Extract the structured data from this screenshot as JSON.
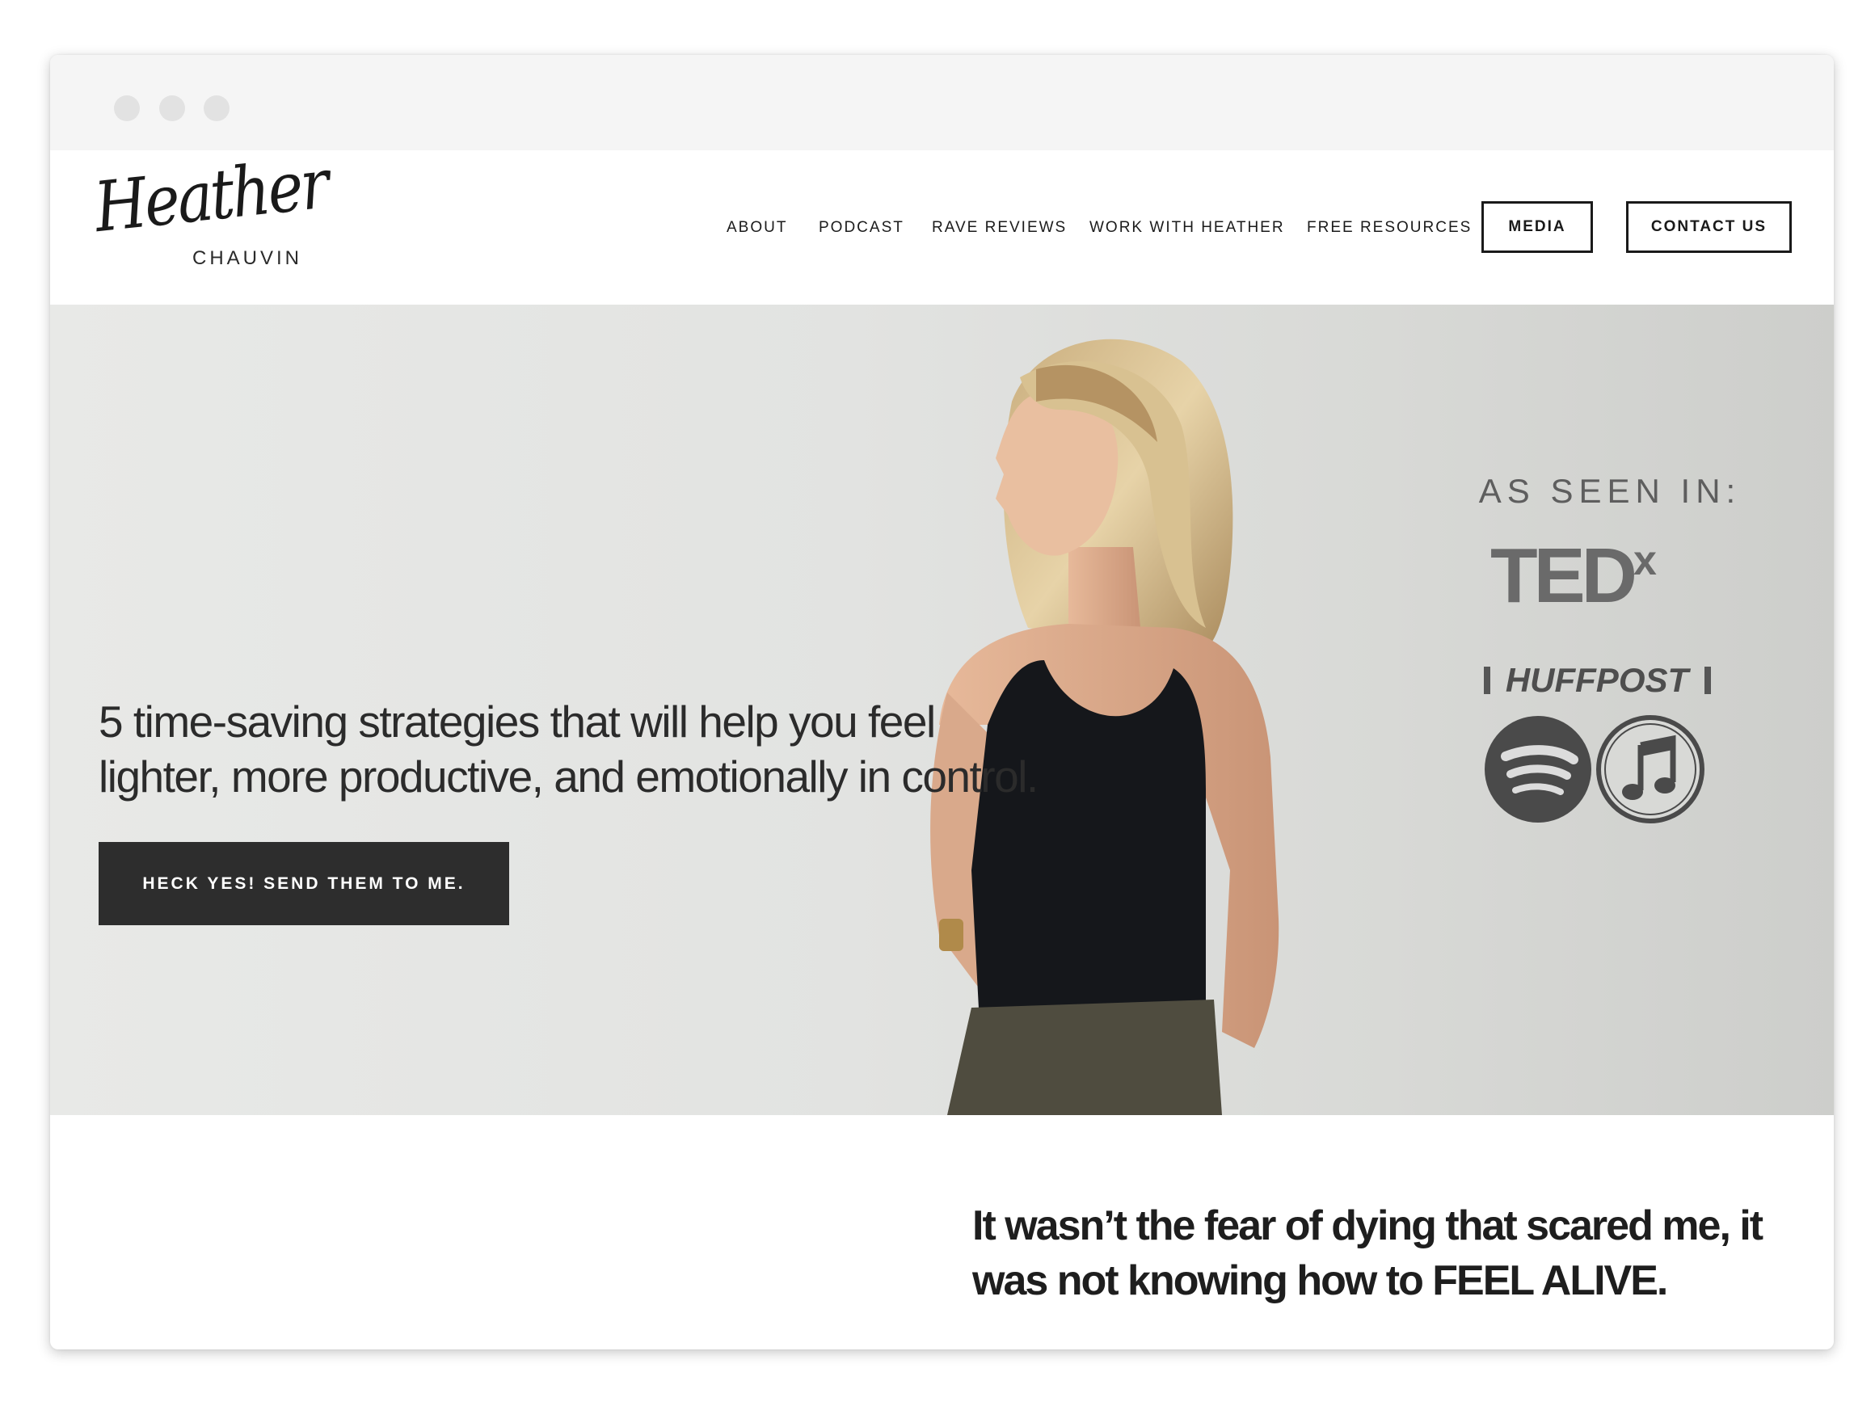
{
  "logo": {
    "script": "Heather",
    "sub": "CHAUVIN"
  },
  "nav": {
    "about": "ABOUT",
    "podcast": "PODCAST",
    "rave_reviews": "RAVE REVIEWS",
    "work_with_heather": "WORK WITH HEATHER",
    "free_resources": "FREE RESOURCES",
    "media": "MEDIA",
    "contact_us": "CONTACT US"
  },
  "hero": {
    "headline_line1": "5 time-saving strategies that will help you feel",
    "headline_line2": "lighter, more productive, and emotionally in control.",
    "cta": "HECK YES! SEND THEM TO ME.",
    "as_seen_in": "AS SEEN IN:",
    "press": {
      "tedx": "TED",
      "tedx_sup": "x",
      "huffpost": "HUFFPOST",
      "icons": [
        "spotify-icon",
        "music-note-icon"
      ]
    }
  },
  "quote": {
    "line1": "It wasn’t the fear of dying that scared me, it",
    "line2": "was not knowing how to FEEL ALIVE."
  },
  "colors": {
    "cta_background": "#2d2d2d",
    "hero_background": "#e2e3e1",
    "text_dark": "#1e1e1e"
  }
}
